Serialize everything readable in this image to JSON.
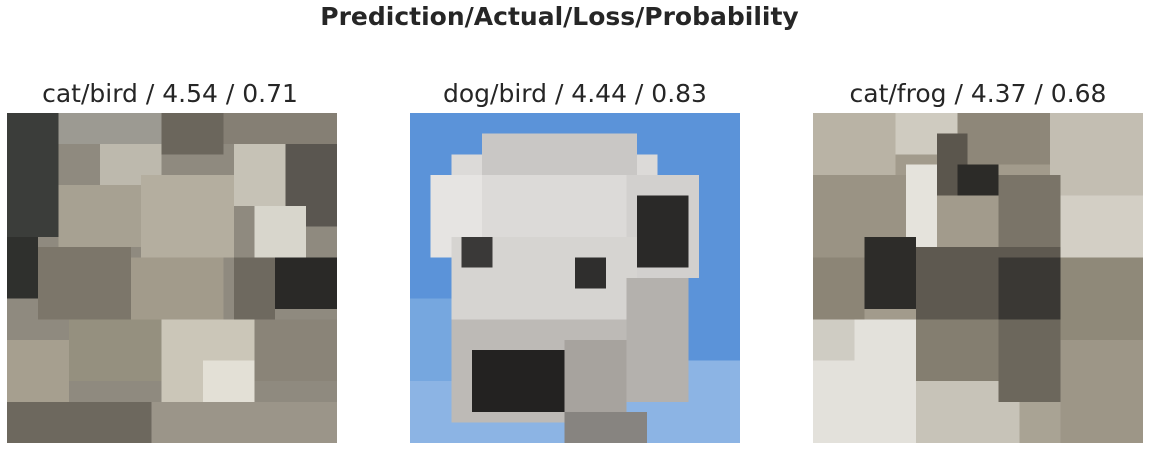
{
  "figure": {
    "title": "Prediction/Actual/Loss/Probability"
  },
  "panels": [
    {
      "label": "cat/bird / 4.54 / 0.71",
      "prediction": "cat",
      "actual": "bird",
      "loss": 4.54,
      "probability": 0.71,
      "image_icon": "pixelated-cat-photo"
    },
    {
      "label": "dog/bird / 4.44 / 0.83",
      "prediction": "dog",
      "actual": "bird",
      "loss": 4.44,
      "probability": 0.83,
      "image_icon": "pixelated-dog-photo"
    },
    {
      "label": "cat/frog / 4.37 / 0.68",
      "prediction": "cat",
      "actual": "frog",
      "loss": 4.37,
      "probability": 0.68,
      "image_icon": "pixelated-cat-photo"
    }
  ]
}
